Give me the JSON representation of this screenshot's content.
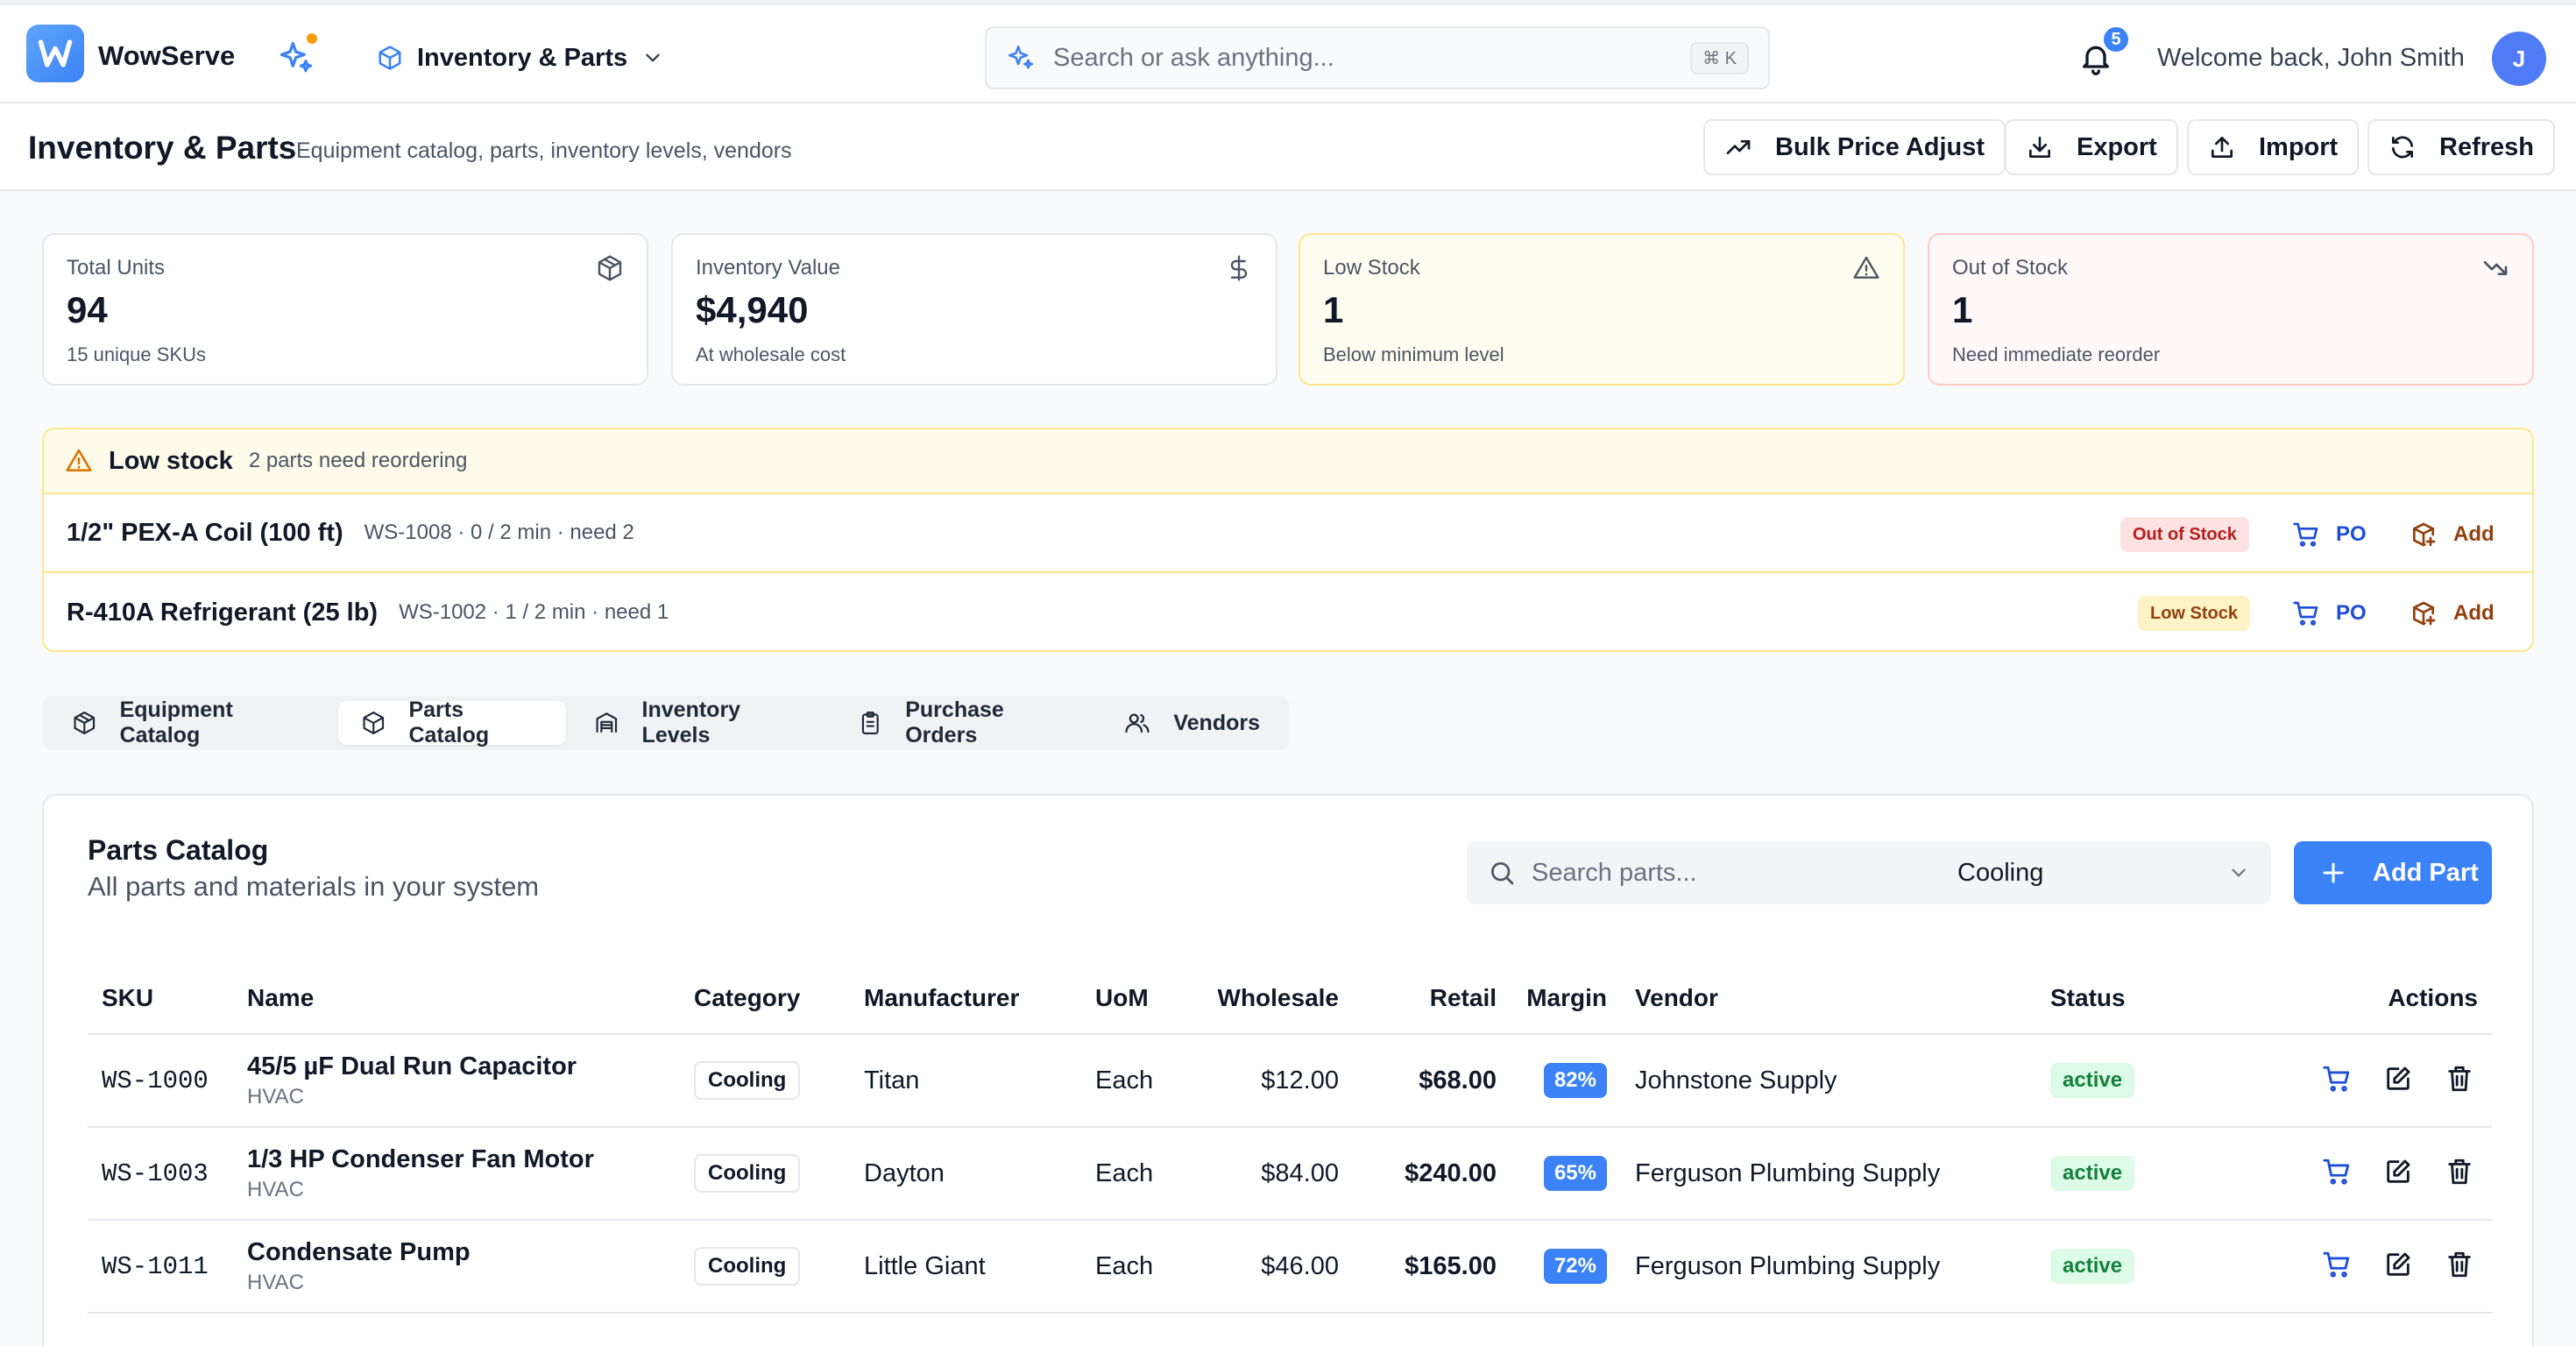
{
  "header": {
    "brand": "WowServe",
    "module": "Inventory & Parts",
    "search_placeholder": "Search or ask anything...",
    "search_shortcut": "⌘ K",
    "notifications": "5",
    "welcome": "Welcome back, John Smith",
    "avatar_initial": "J"
  },
  "page": {
    "title": "Inventory & Parts",
    "subtitle": "Equipment catalog, parts, inventory levels, vendors",
    "buttons": {
      "bulk": "Bulk Price Adjust",
      "export": "Export",
      "import": "Import",
      "refresh": "Refresh"
    }
  },
  "stats": [
    {
      "label": "Total Units",
      "value": "94",
      "note": "15 unique SKUs"
    },
    {
      "label": "Inventory Value",
      "value": "$4,940",
      "note": "At wholesale cost"
    },
    {
      "label": "Low Stock",
      "value": "1",
      "note": "Below minimum level"
    },
    {
      "label": "Out of Stock",
      "value": "1",
      "note": "Need immediate reorder"
    }
  ],
  "low_stock": {
    "title": "Low stock",
    "subtitle": "2 parts need reordering",
    "rows": [
      {
        "name": "1/2\" PEX-A Coil (100 ft)",
        "meta": "WS-1008 · 0 / 2 min · need 2",
        "badge": "Out of Stock",
        "po": "PO",
        "add": "Add"
      },
      {
        "name": "R-410A Refrigerant (25 lb)",
        "meta": "WS-1002 · 1 / 2 min · need 1",
        "badge": "Low Stock",
        "po": "PO",
        "add": "Add"
      }
    ]
  },
  "tabs": [
    "Equipment Catalog",
    "Parts Catalog",
    "Inventory Levels",
    "Purchase Orders",
    "Vendors"
  ],
  "catalog": {
    "title": "Parts Catalog",
    "subtitle": "All parts and materials in your system",
    "search_placeholder": "Search parts...",
    "filter": "Cooling",
    "add_label": "Add Part",
    "columns": [
      "SKU",
      "Name",
      "Category",
      "Manufacturer",
      "UoM",
      "Wholesale",
      "Retail",
      "Margin",
      "Vendor",
      "Status",
      "Actions"
    ],
    "rows": [
      {
        "sku": "WS-1000",
        "name": "45/5 µF Dual Run Capacitor",
        "sub": "HVAC",
        "category": "Cooling",
        "manufacturer": "Titan",
        "uom": "Each",
        "wholesale": "$12.00",
        "retail": "$68.00",
        "margin": "82%",
        "vendor": "Johnstone Supply",
        "status": "active"
      },
      {
        "sku": "WS-1003",
        "name": "1/3 HP Condenser Fan Motor",
        "sub": "HVAC",
        "category": "Cooling",
        "manufacturer": "Dayton",
        "uom": "Each",
        "wholesale": "$84.00",
        "retail": "$240.00",
        "margin": "65%",
        "vendor": "Ferguson Plumbing Supply",
        "status": "active"
      },
      {
        "sku": "WS-1011",
        "name": "Condensate Pump",
        "sub": "HVAC",
        "category": "Cooling",
        "manufacturer": "Little Giant",
        "uom": "Each",
        "wholesale": "$46.00",
        "retail": "$165.00",
        "margin": "72%",
        "vendor": "Ferguson Plumbing Supply",
        "status": "active"
      }
    ]
  },
  "colors": {
    "accent": "#3b82f6",
    "warning": "#f59e0b",
    "danger": "#ef4444",
    "success": "#15803d"
  }
}
